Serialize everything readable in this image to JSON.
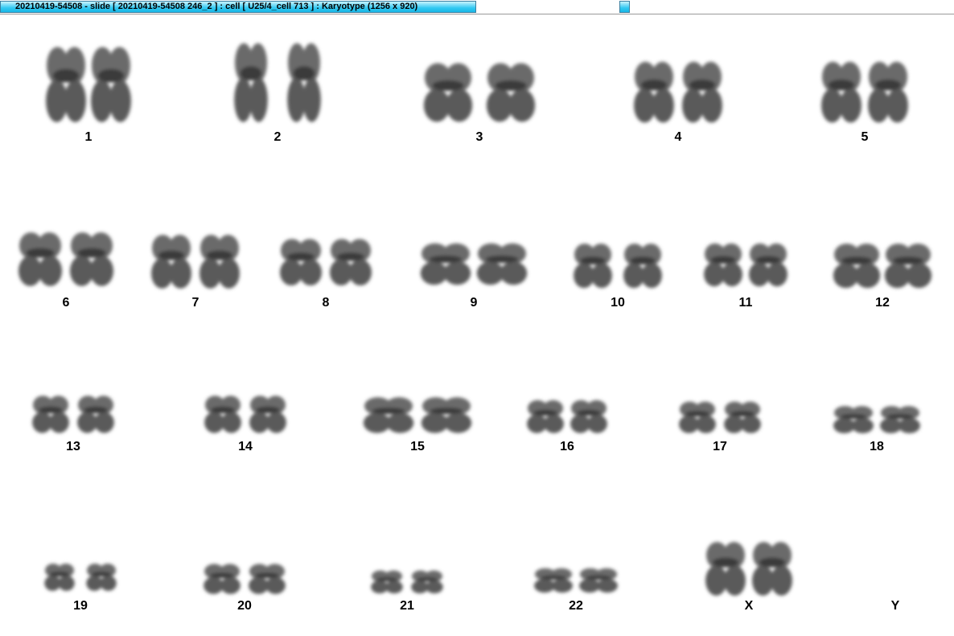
{
  "window": {
    "title": "20210419-54508 - slide [ 20210419-54508 246_2 ] : cell [ U25/4_cell 713 ] : Karyotype  (1256 x 920)"
  },
  "karyotype": {
    "pairs": [
      {
        "id": "chr1",
        "label": "1"
      },
      {
        "id": "chr2",
        "label": "2"
      },
      {
        "id": "chr3",
        "label": "3"
      },
      {
        "id": "chr4",
        "label": "4"
      },
      {
        "id": "chr5",
        "label": "5"
      },
      {
        "id": "chr6",
        "label": "6"
      },
      {
        "id": "chr7",
        "label": "7"
      },
      {
        "id": "chr8",
        "label": "8"
      },
      {
        "id": "chr9",
        "label": "9"
      },
      {
        "id": "chr10",
        "label": "10"
      },
      {
        "id": "chr11",
        "label": "11"
      },
      {
        "id": "chr12",
        "label": "12"
      },
      {
        "id": "chr13",
        "label": "13"
      },
      {
        "id": "chr14",
        "label": "14"
      },
      {
        "id": "chr15",
        "label": "15"
      },
      {
        "id": "chr16",
        "label": "16"
      },
      {
        "id": "chr17",
        "label": "17"
      },
      {
        "id": "chr18",
        "label": "18"
      },
      {
        "id": "chr19",
        "label": "19"
      },
      {
        "id": "chr20",
        "label": "20"
      },
      {
        "id": "chr21",
        "label": "21"
      },
      {
        "id": "chr22",
        "label": "22"
      },
      {
        "id": "chrX",
        "label": "X"
      },
      {
        "id": "chrY",
        "label": "Y"
      }
    ]
  }
}
